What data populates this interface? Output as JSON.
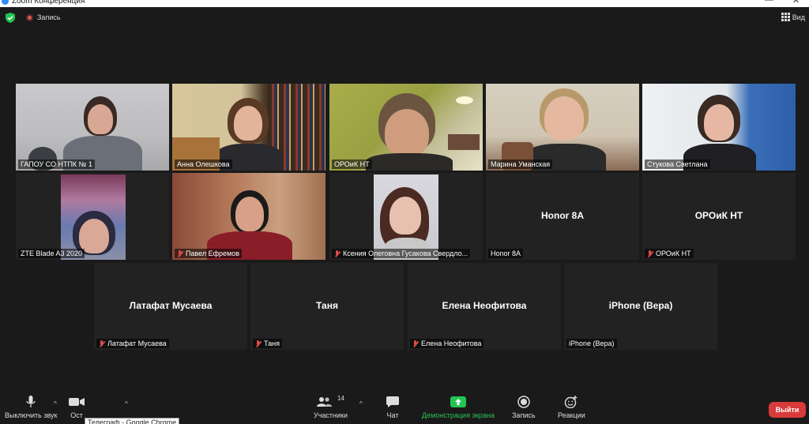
{
  "window": {
    "title": "Zoom Конференция"
  },
  "topbar": {
    "record_label": "Запись",
    "view_label": "Вид"
  },
  "tiles": [
    {
      "name": "ГАПОУ СО НТПК № 1",
      "muted": false
    },
    {
      "name": "Анна Олешкова",
      "muted": false
    },
    {
      "name": "ОРОиК НТ",
      "muted": false
    },
    {
      "name": "Марина Уманская",
      "muted": false
    },
    {
      "name": "Стукова Светлана",
      "muted": false
    },
    {
      "name": "ZTE Blade A3 2020",
      "muted": false
    },
    {
      "name": "Павел Ефремов",
      "muted": true
    },
    {
      "name": "Ксения Олеговна Гусакова Свердло...",
      "muted": true
    },
    {
      "name": "Honor 8A",
      "center": "Honor 8A",
      "muted": false
    },
    {
      "name": "ОРОиК НТ",
      "center": "ОРОиК НТ",
      "muted": true
    },
    {
      "name": "Латафат Мусаева",
      "center": "Латафат Мусаева",
      "muted": true
    },
    {
      "name": "Таня",
      "center": "Таня",
      "muted": true
    },
    {
      "name": "Елена Неофитова",
      "center": "Елена Неофитова",
      "muted": true
    },
    {
      "name": "iPhone (Вера)",
      "center": "iPhone (Вера)",
      "muted": false
    }
  ],
  "toolbar": {
    "mute_label": "Выключить звук",
    "video_label": "Ост",
    "participants_label": "Участники",
    "participants_count": "14",
    "chat_label": "Чат",
    "share_label": "Демонстрация экрана",
    "record_label": "Запись",
    "reactions_label": "Реакции",
    "leave_label": "Выйти"
  },
  "tooltip": {
    "text": "Телеграф - Google Chrome"
  },
  "colors": {
    "active_border": "#b8d94a",
    "share_green": "#23c552",
    "leave_red": "#d93a3a",
    "mute_red": "#e04b4b"
  }
}
